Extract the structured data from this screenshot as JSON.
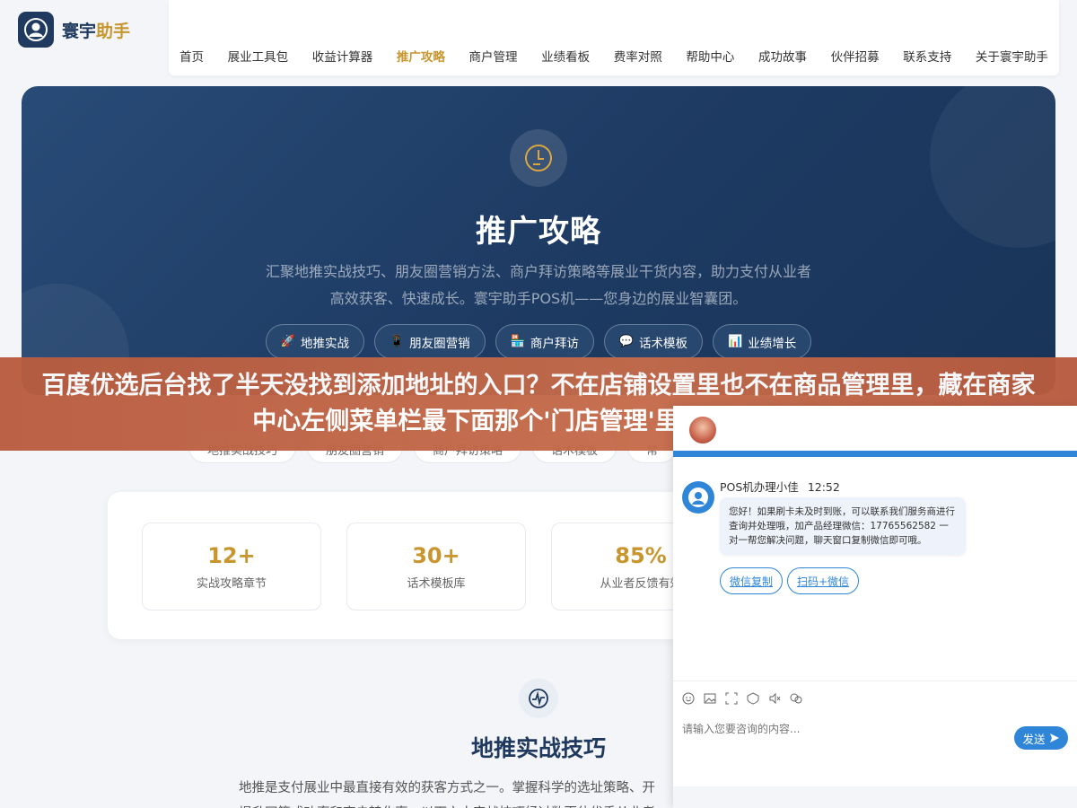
{
  "brand": {
    "name_main": "寰宇",
    "name_accent": "助手"
  },
  "nav": {
    "items": [
      "首页",
      "展业工具包",
      "收益计算器",
      "推广攻略",
      "商户管理",
      "业绩看板",
      "费率对照",
      "帮助中心",
      "成功故事",
      "伙伴招募",
      "联系支持",
      "关于寰宇助手"
    ],
    "active_index": 3
  },
  "hero": {
    "icon": "clock-icon",
    "title": "推广攻略",
    "description": "汇聚地推实战技巧、朋友圈营销方法、商户拜访策略等展业干货内容，助力支付从业者高效获客、快速成长。寰宇助手POS机——您身边的展业智囊团。",
    "pills": [
      {
        "emoji": "🚀",
        "label": "地推实战"
      },
      {
        "emoji": "📱",
        "label": "朋友圈营销"
      },
      {
        "emoji": "🏪",
        "label": "商户拜访"
      },
      {
        "emoji": "💬",
        "label": "话术模板"
      },
      {
        "emoji": "📊",
        "label": "业绩增长"
      }
    ]
  },
  "banner": {
    "text": "百度优选后台找了半天没找到添加地址的入口？不在店铺设置里也不在商品管理里，藏在商家中心左侧菜单栏最下面那个'门店管理'里面，填完地址"
  },
  "chapters": [
    "地推实战技巧",
    "朋友圈营销",
    "商户拜访策略",
    "话术模板",
    "常"
  ],
  "stats": [
    {
      "value": "12+",
      "label": "实战攻略章节"
    },
    {
      "value": "30+",
      "label": "话术模板库"
    },
    {
      "value": "85%",
      "label": "从业者反馈有效"
    }
  ],
  "section": {
    "icon": "pulse-icon",
    "title": "地推实战技巧",
    "text_line1": "地推是支付展业中最直接有效的获客方式之一。掌握科学的选址策略、开",
    "text_line2": "提升网签成功率和商户转化率。以下六大实战技巧经过数百位优秀从业者"
  },
  "chat": {
    "agent_name": "POS机办理小佳",
    "time": "12:52",
    "message": "您好！如果刷卡未及时到账，可以联系我们服务商进行查询并处理哦，加产品经理微信：17765562582 一对一帮您解决问题，聊天窗口复制微信即可哦。",
    "quick_replies": [
      "微信复制",
      "扫码+微信"
    ],
    "input_placeholder": "请输入您要咨询的内容...",
    "send_label": "发送",
    "accent": "#2f86d8"
  }
}
